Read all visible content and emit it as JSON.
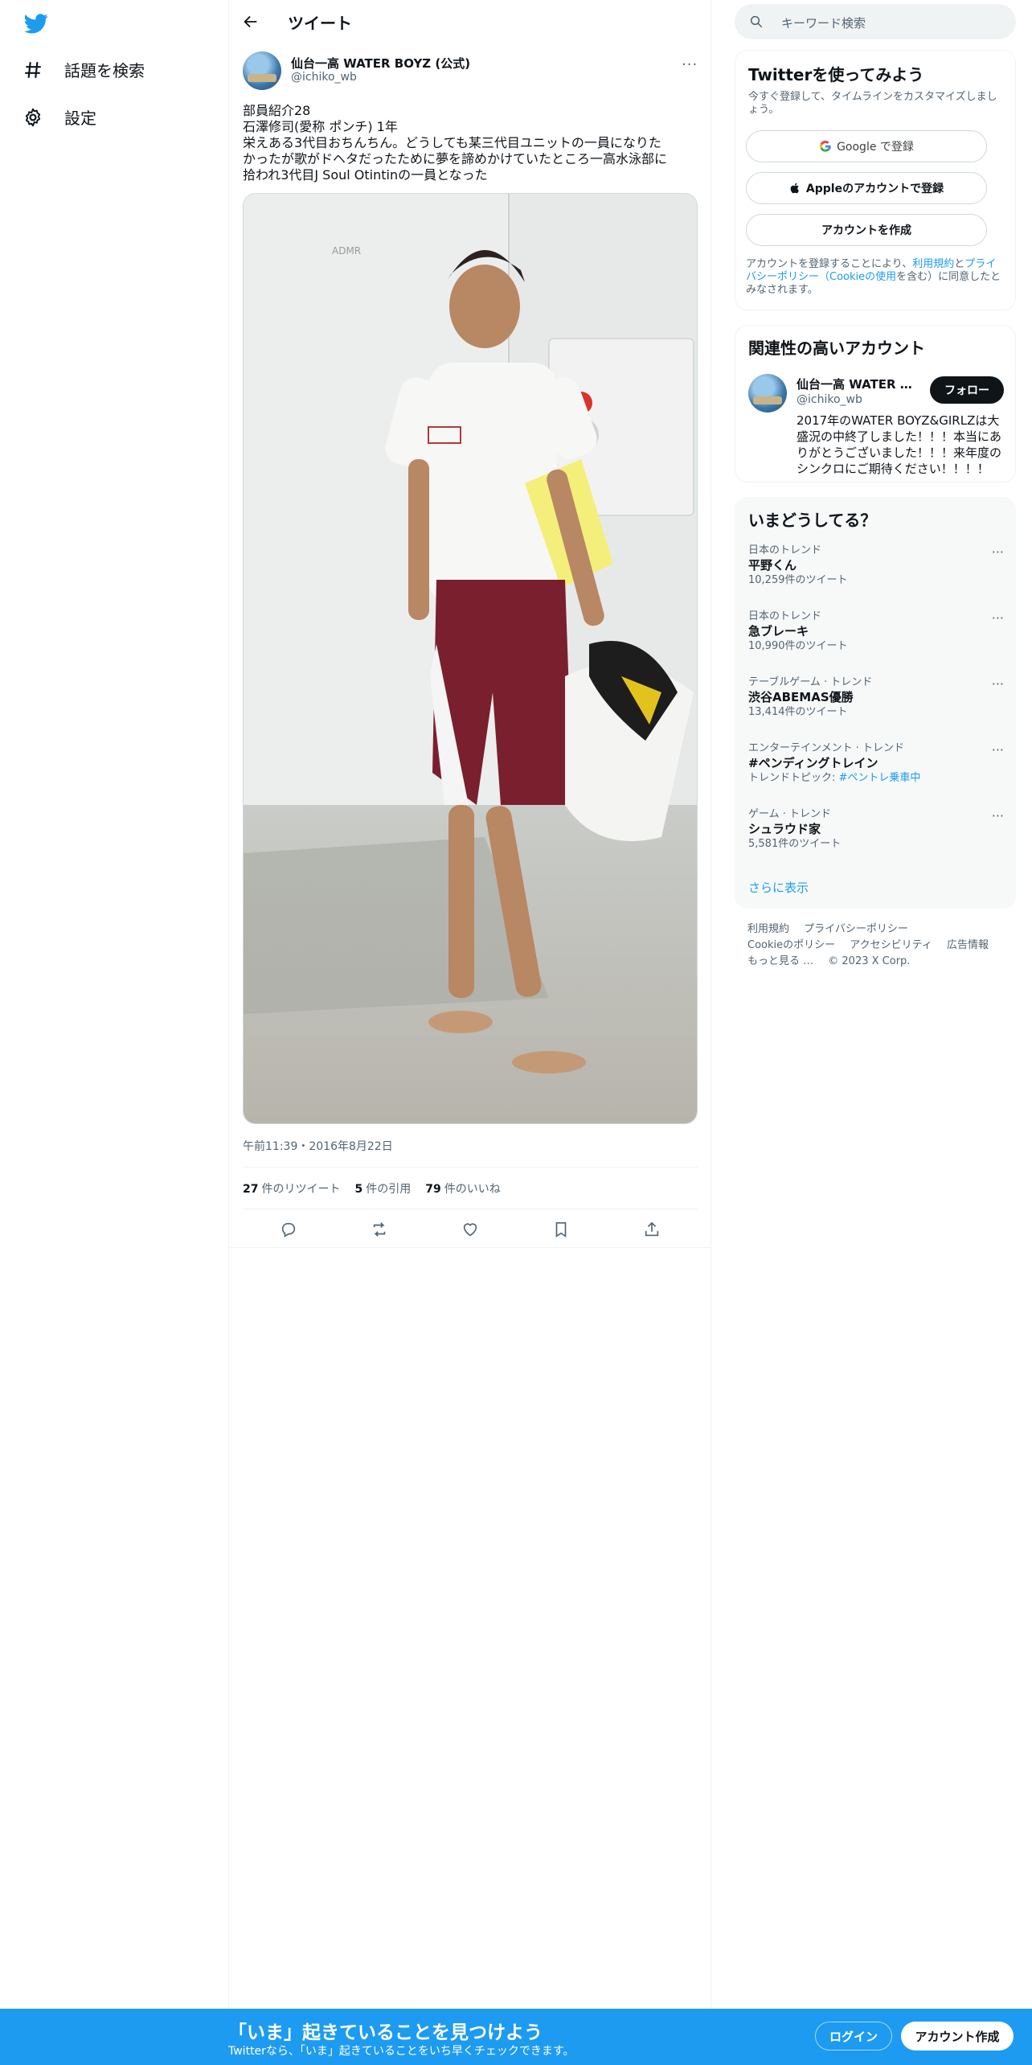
{
  "nav": {
    "logo_icon": "twitter-bird-icon",
    "explore_label": "話題を検索",
    "settings_label": "設定"
  },
  "header": {
    "title": "ツイート"
  },
  "tweet": {
    "author_name": "仙台一高 WATER BOYZ (公式)",
    "author_handle": "@ichiko_wb",
    "text_lines": [
      "部員紹介28",
      "石澤修司(愛称 ポンチ) 1年",
      "栄えある3代目おちんちん。どうしても某三代目ユニットの一員になりた",
      "かったが歌がドヘタだったために夢を諦めかけていたところ一高水泳部に",
      "拾われ3代目J Soul Otintinの一員となった"
    ],
    "timestamp": "午前11:39・2016年8月22日",
    "retweets_count": "27",
    "retweets_label": "件のリツイート",
    "quotes_count": "5",
    "quotes_label": "件の引用",
    "likes_count": "79",
    "likes_label": "件のいいね"
  },
  "search": {
    "placeholder": "キーワード検索"
  },
  "signup_card": {
    "title": "Twitterを使ってみよう",
    "subtitle": "今すぐ登録して、タイムラインをカスタマイズしましょう。",
    "google_button": "Google で登録",
    "apple_button": "Appleのアカウントで登録",
    "create_button": "アカウントを作成",
    "terms_prefix": "アカウントを登録することにより、",
    "terms_link1": "利用規約",
    "terms_and": "と",
    "terms_link2": "プライバシーポリシー（Cookieの使用",
    "terms_suffix": "を含む）に同意したとみなされます。"
  },
  "related": {
    "title": "関連性の高いアカウント",
    "name": "仙台一高 WATER BOYZ (公式)",
    "handle": "@ichiko_wb",
    "follow_label": "フォロー",
    "bio": "2017年のWATER BOYZ&GIRLZは大盛況の中終了しました！！！本当にありがとうございました！！！来年度のシンクロにご期待ください！！！！"
  },
  "trends": {
    "title": "いまどうしてる？",
    "items": [
      {
        "category": "日本のトレンド",
        "name": "平野くん",
        "count": "10,259件のツイート"
      },
      {
        "category": "日本のトレンド",
        "name": "急ブレーキ",
        "count": "10,990件のツイート"
      },
      {
        "category": "テーブルゲーム · トレンド",
        "name": "渋谷ABEMAS優勝",
        "count": "13,414件のツイート"
      },
      {
        "category": "エンターテインメント · トレンド",
        "name": "#ペンディングトレイン",
        "count_prefix": "トレンドトピック: ",
        "count_link": "#ペントレ乗車中"
      },
      {
        "category": "ゲーム · トレンド",
        "name": "シュラウド家",
        "count": "5,581件のツイート"
      }
    ],
    "show_more": "さらに表示"
  },
  "footer": {
    "terms": "利用規約",
    "privacy": "プライバシーポリシー",
    "cookie": "Cookieのポリシー",
    "accessibility": "アクセシビリティ",
    "ads": "広告情報",
    "more": "もっと見る …",
    "copyright": "© 2023 X Corp."
  },
  "bottom_bar": {
    "title": "「いま」起きていることを見つけよう",
    "subtitle": "Twitterなら、「いま」起きていることをいち早くチェックできます。",
    "login": "ログイン",
    "signup": "アカウント作成"
  },
  "colors": {
    "accent": "#1d9bf0",
    "text": "#0f1419",
    "muted": "#536471"
  }
}
